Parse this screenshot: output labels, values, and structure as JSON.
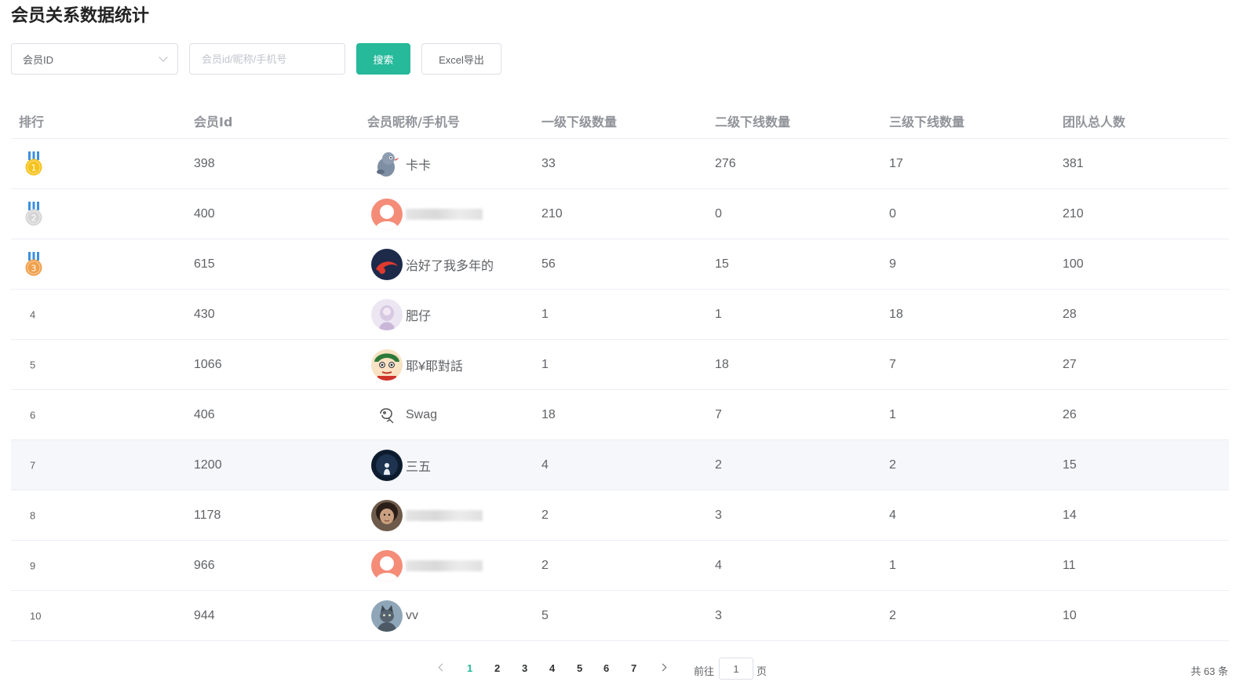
{
  "page": {
    "title": "会员关系数据统计"
  },
  "filter": {
    "select_value": "会员ID",
    "search_placeholder": "会员id/昵称/手机号",
    "search_label": "搜索",
    "export_label": "Excel导出"
  },
  "table": {
    "columns": [
      "排行",
      "会员Id",
      "会员昵称/手机号",
      "一级下级数量",
      "二级下线数量",
      "三级下线数量",
      "团队总人数"
    ],
    "rows": [
      {
        "rank": "1",
        "medal": "gold",
        "id": "398",
        "nickname": "卡卡",
        "avatar": "cartoon-mascot",
        "level1": "33",
        "level2": "276",
        "level3": "17",
        "team": "381"
      },
      {
        "rank": "2",
        "medal": "silver",
        "id": "400",
        "nickname": "",
        "avatar": "default-orange",
        "level1": "210",
        "level2": "0",
        "level3": "0",
        "team": "210"
      },
      {
        "rank": "3",
        "medal": "bronze",
        "id": "615",
        "nickname": "治好了我多年的",
        "avatar": "dark-red-swirl",
        "level1": "56",
        "level2": "15",
        "level3": "9",
        "team": "100"
      },
      {
        "rank": "4",
        "medal": "",
        "id": "430",
        "nickname": "肥仔",
        "avatar": "pastel-girl",
        "level1": "1",
        "level2": "1",
        "level3": "18",
        "team": "28"
      },
      {
        "rank": "5",
        "medal": "",
        "id": "1066",
        "nickname": "耶¥耶對話",
        "avatar": "crayon-boy",
        "level1": "1",
        "level2": "18",
        "level3": "7",
        "team": "27"
      },
      {
        "rank": "6",
        "medal": "",
        "id": "406",
        "nickname": "Swag",
        "avatar": "sketch-doodle",
        "level1": "18",
        "level2": "7",
        "level3": "1",
        "team": "26"
      },
      {
        "rank": "7",
        "medal": "",
        "id": "1200",
        "nickname": "三五",
        "avatar": "night-figure",
        "level1": "4",
        "level2": "2",
        "level3": "2",
        "team": "15"
      },
      {
        "rank": "8",
        "medal": "",
        "id": "1178",
        "nickname": "",
        "avatar": "photo-face",
        "level1": "2",
        "level2": "3",
        "level3": "4",
        "team": "14"
      },
      {
        "rank": "9",
        "medal": "",
        "id": "966",
        "nickname": "",
        "avatar": "default-orange",
        "level1": "2",
        "level2": "4",
        "level3": "1",
        "team": "11"
      },
      {
        "rank": "10",
        "medal": "",
        "id": "944",
        "nickname": "vv",
        "avatar": "cat-photo",
        "level1": "5",
        "level2": "3",
        "level3": "2",
        "team": "10"
      }
    ]
  },
  "pagination": {
    "pages": [
      "1",
      "2",
      "3",
      "4",
      "5",
      "6",
      "7"
    ],
    "current": "1",
    "goto_prefix": "前往",
    "goto_value": "1",
    "goto_suffix": "页",
    "total": "共 63 条"
  },
  "colors": {
    "accent": "#26b99a",
    "gold": "#f6c21b",
    "silver": "#d6d6d6",
    "bronze": "#f0a04b",
    "medal_ribbon": "#3d8fe0"
  }
}
